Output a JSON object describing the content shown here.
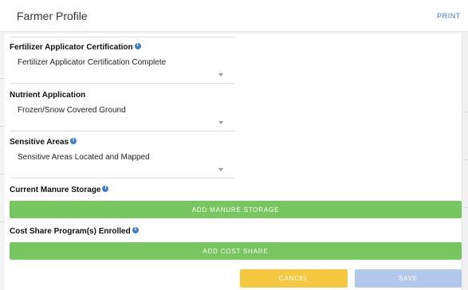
{
  "header": {
    "title": "Farmer Profile",
    "print_label": "PRINT"
  },
  "sections": {
    "fertilizer": {
      "label": "Fertilizer Applicator Certification",
      "value": "Fertilizer Applicator Certification Complete"
    },
    "nutrient": {
      "label": "Nutrient Application",
      "value": "Frozen/Snow Covered Ground"
    },
    "sensitive": {
      "label": "Sensitive Areas",
      "value": "Sensitive Areas Located and Mapped"
    },
    "manure": {
      "label": "Current Manure Storage",
      "button": "ADD MANURE STORAGE"
    },
    "cost_share": {
      "label": "Cost Share Program(s) Enrolled",
      "button": "ADD COST SHARE"
    }
  },
  "footer": {
    "cancel_label": "CANCEL",
    "save_label": "SAVE"
  },
  "colors": {
    "primary_green": "#77c661",
    "cancel_yellow": "#f5c842",
    "save_disabled_blue": "#b2c8ea",
    "link_blue": "#3b7dc4",
    "info_blue": "#3f7fc9"
  }
}
